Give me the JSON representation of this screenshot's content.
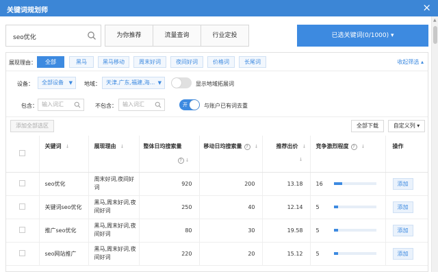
{
  "window": {
    "title": "关键词规划师",
    "close": "×"
  },
  "search": {
    "value": "seo优化"
  },
  "tabs": [
    "为你推荐",
    "流量查询",
    "行业定投"
  ],
  "selected_button": "已选关键词(0/1000) ▾",
  "filter": {
    "reason_label": "展现理由：",
    "chips": [
      "全部",
      "黑马",
      "黑马移动",
      "周末好词",
      "夜间好词",
      "价格词",
      "长尾词"
    ],
    "collapse": "收起筛选 ▴",
    "device_label": "设备：",
    "device_value": "全部设备",
    "region_label": "地域：",
    "region_value": "天津,广东,福建,海...",
    "show_region_expand": "显示地域拓展词",
    "include_label": "包含：",
    "include_placeholder": "输入词汇",
    "exclude_label": "不包含：",
    "exclude_placeholder": "输入词汇",
    "dedupe_toggle_text": "开",
    "dedupe_label": "与账户已有词去重"
  },
  "toolbar": {
    "add_all": "添加全部选区",
    "download_all": "全部下载",
    "custom_columns": "自定义列 ▾"
  },
  "table": {
    "headers": [
      "关键词",
      "展现理由",
      "整体日均搜索量",
      "移动日均搜索量",
      "推荐出价",
      "竞争激烈程度",
      "操作"
    ],
    "rows": [
      {
        "keyword": "seo优化",
        "reason": "周末好词,夜间好词",
        "total": "920",
        "mobile": "200",
        "bid": "13.18",
        "comp": "16",
        "comp_pct": 0.16,
        "action": "添加"
      },
      {
        "keyword": "关键词seo优化",
        "reason": "黑马,周末好词,夜间好词",
        "total": "250",
        "mobile": "40",
        "bid": "12.14",
        "comp": "5",
        "comp_pct": 0.05,
        "action": "添加"
      },
      {
        "keyword": "推广seo优化",
        "reason": "黑马,周末好词,夜间好词",
        "total": "80",
        "mobile": "30",
        "bid": "19.58",
        "comp": "5",
        "comp_pct": 0.05,
        "action": "添加"
      },
      {
        "keyword": "seo网站推广",
        "reason": "黑马,周末好词,夜间好词",
        "total": "220",
        "mobile": "20",
        "bid": "15.12",
        "comp": "5",
        "comp_pct": 0.05,
        "action": "添加"
      }
    ]
  },
  "colors": {
    "accent": "#3d8ae0",
    "titlebar": "#3c86d6"
  }
}
